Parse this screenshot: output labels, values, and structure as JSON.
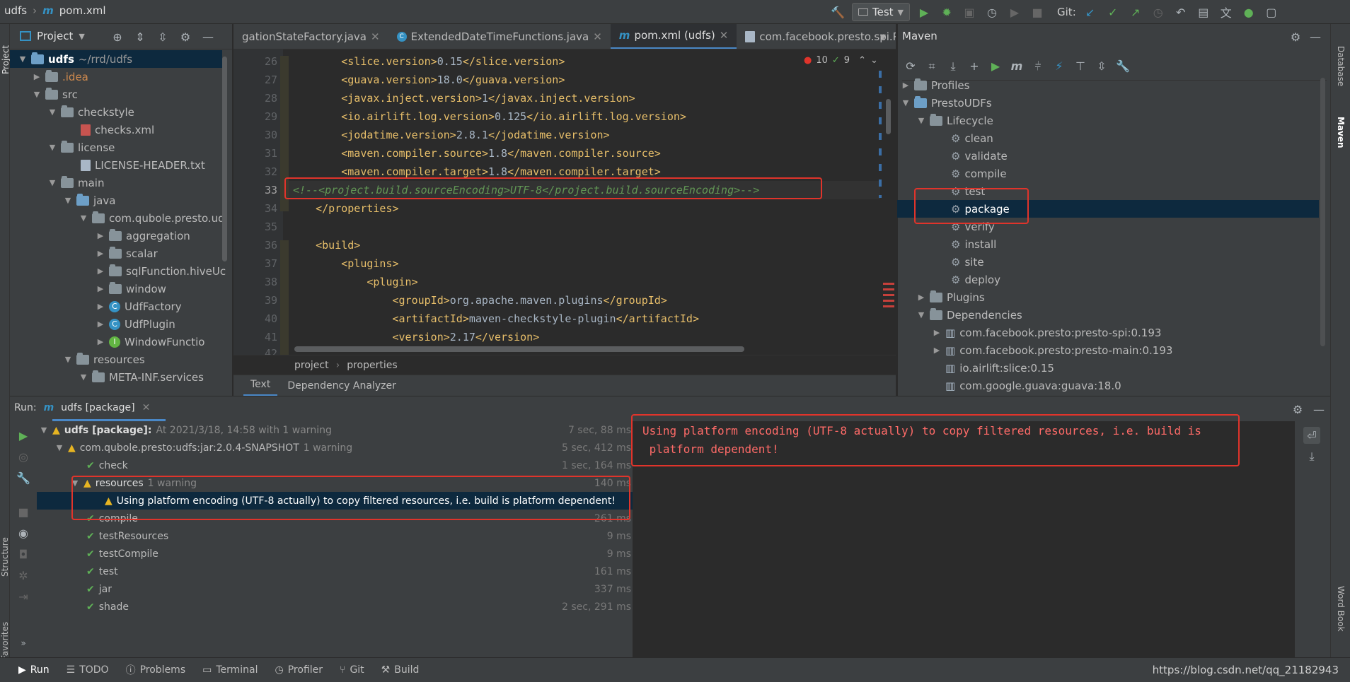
{
  "topbar": {
    "project": "udfs",
    "separator": "›",
    "file_icon": "m",
    "file": "pom.xml",
    "run_config": "Test",
    "git_label": "Git:"
  },
  "project_panel": {
    "title": "Project",
    "tree": [
      {
        "label": "udfs",
        "extra": "~/rrd/udfs"
      },
      {
        "label": ".idea"
      },
      {
        "label": "src"
      },
      {
        "label": "checkstyle"
      },
      {
        "label": "checks.xml"
      },
      {
        "label": "license"
      },
      {
        "label": "LICENSE-HEADER.txt"
      },
      {
        "label": "main"
      },
      {
        "label": "java"
      },
      {
        "label": "com.qubole.presto.ud"
      },
      {
        "label": "aggregation"
      },
      {
        "label": "scalar"
      },
      {
        "label": "sqlFunction.hiveUc"
      },
      {
        "label": "window"
      },
      {
        "label": "UdfFactory"
      },
      {
        "label": "UdfPlugin"
      },
      {
        "label": "WindowFunctio"
      },
      {
        "label": "resources"
      },
      {
        "label": "META-INF.services"
      }
    ]
  },
  "editor": {
    "tabs": [
      {
        "label": "gationStateFactory.java"
      },
      {
        "label": "ExtendedDateTimeFunctions.java"
      },
      {
        "label": "pom.xml (udfs)",
        "icon_text": "m"
      },
      {
        "label": "com.facebook.presto.spi.Plugin"
      }
    ],
    "inspection": {
      "errors": "10",
      "warnings": "9"
    },
    "lines": [
      {
        "num": "26",
        "indent": "        ",
        "tag": "slice.version",
        "value": "0.15"
      },
      {
        "num": "27",
        "indent": "        ",
        "tag": "guava.version",
        "value": "18.0"
      },
      {
        "num": "28",
        "indent": "        ",
        "tag": "javax.inject.version",
        "value": "1"
      },
      {
        "num": "29",
        "indent": "        ",
        "tag": "io.airlift.log.version",
        "value": "0.125"
      },
      {
        "num": "30",
        "indent": "        ",
        "tag": "jodatime.version",
        "value": "2.8.1"
      },
      {
        "num": "31",
        "indent": "        ",
        "tag": "maven.compiler.source",
        "value": "1.8"
      },
      {
        "num": "32",
        "indent": "        ",
        "tag": "maven.compiler.target",
        "value": "1.8"
      },
      {
        "num": "33",
        "comment": "<!--<project.build.sourceEncoding>UTF-8</project.build.sourceEncoding>-->"
      },
      {
        "num": "34",
        "indent": "    ",
        "close": "</properties>"
      },
      {
        "num": "35"
      },
      {
        "num": "36",
        "indent": "    ",
        "open": "<build>"
      },
      {
        "num": "37",
        "indent": "        ",
        "open": "<plugins>"
      },
      {
        "num": "38",
        "indent": "            ",
        "open": "<plugin>"
      },
      {
        "num": "39",
        "indent": "                ",
        "tag": "groupId",
        "value": "org.apache.maven.plugins"
      },
      {
        "num": "40",
        "indent": "                ",
        "tag": "artifactId",
        "value": "maven-checkstyle-plugin"
      },
      {
        "num": "41",
        "indent": "                ",
        "tag": "version",
        "value": "2.17"
      },
      {
        "num": "42"
      }
    ],
    "breadcrumb": [
      "project",
      "properties"
    ],
    "bottom_tabs": [
      "Text",
      "Dependency Analyzer"
    ]
  },
  "maven": {
    "title": "Maven",
    "items": [
      {
        "label": "Profiles"
      },
      {
        "label": "PrestoUDFs"
      },
      {
        "label": "Lifecycle"
      },
      {
        "label": "clean"
      },
      {
        "label": "validate"
      },
      {
        "label": "compile"
      },
      {
        "label": "test"
      },
      {
        "label": "package"
      },
      {
        "label": "verify"
      },
      {
        "label": "install"
      },
      {
        "label": "site"
      },
      {
        "label": "deploy"
      },
      {
        "label": "Plugins"
      },
      {
        "label": "Dependencies"
      },
      {
        "label": "com.facebook.presto:presto-spi:0.193"
      },
      {
        "label": "com.facebook.presto:presto-main:0.193"
      },
      {
        "label": "io.airlift:slice:0.15"
      },
      {
        "label": "com.google.guava:guava:18.0"
      }
    ]
  },
  "run": {
    "label": "Run:",
    "tab": "udfs [package]",
    "tree": [
      {
        "label": "udfs [package]:",
        "extra": "At 2021/3/18, 14:58 with 1 warning",
        "time": "7 sec, 88 ms"
      },
      {
        "label": "com.qubole.presto:udfs:jar:2.0.4-SNAPSHOT",
        "extra": "1 warning",
        "time": "5 sec, 412 ms"
      },
      {
        "label": "check",
        "time": "1 sec, 164 ms"
      },
      {
        "label": "resources",
        "extra": "1 warning",
        "time": "140 ms"
      },
      {
        "label": "Using platform encoding (UTF-8 actually) to copy filtered resources, i.e. build is platform dependent!",
        "time": ""
      },
      {
        "label": "compile",
        "time": "261 ms"
      },
      {
        "label": "testResources",
        "time": "9 ms"
      },
      {
        "label": "testCompile",
        "time": "9 ms"
      },
      {
        "label": "test",
        "time": "161 ms"
      },
      {
        "label": "jar",
        "time": "337 ms"
      },
      {
        "label": "shade",
        "time": "2 sec, 291 ms"
      }
    ],
    "console": [
      "Using platform encoding (UTF-8 actually) to copy filtered resources, i.e. build is",
      " platform dependent!"
    ]
  },
  "side_labels": {
    "left_top": "Project",
    "left_structure": "Structure",
    "left_favorites": "Favorites",
    "right_database": "Database",
    "right_maven": "Maven",
    "right_wordbook": "Word Book"
  },
  "statusbar": {
    "tabs": [
      "Run",
      "TODO",
      "Problems",
      "Terminal",
      "Profiler",
      "Git",
      "Build"
    ],
    "watermark": "https://blog.csdn.net/qq_21182943"
  }
}
